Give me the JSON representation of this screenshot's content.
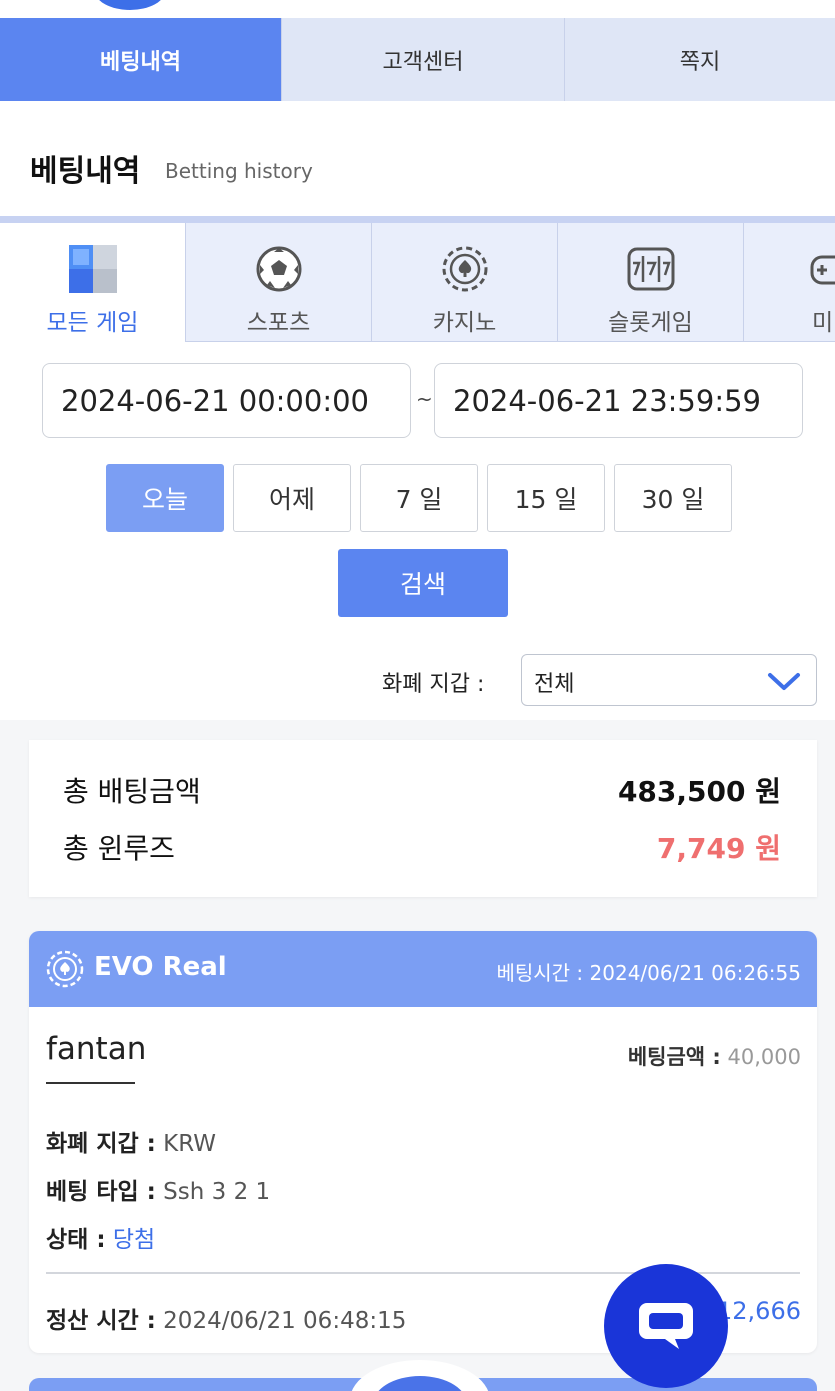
{
  "nav": {
    "tabs": [
      {
        "label": "베팅내역",
        "active": true
      },
      {
        "label": "고객센터",
        "active": false
      },
      {
        "label": "쪽지",
        "active": false
      }
    ]
  },
  "header": {
    "title": "베팅내역",
    "subtitle": "Betting history"
  },
  "game_tabs": [
    {
      "label": "모든 게임",
      "icon": "cube-icon",
      "active": true
    },
    {
      "label": "스포츠",
      "icon": "soccer-ball-icon"
    },
    {
      "label": "카지노",
      "icon": "casino-chip-icon"
    },
    {
      "label": "슬롯게임",
      "icon": "slot-machine-icon"
    },
    {
      "label": "미",
      "icon": "gamepad-icon"
    }
  ],
  "filter": {
    "date_from": "2024-06-21 00:00:00",
    "separator": "~",
    "date_to": "2024-06-21 23:59:59",
    "quick_ranges": [
      "오늘",
      "어제",
      "7 일",
      "15 일",
      "30 일"
    ],
    "active_range": "오늘",
    "search_label": "검색",
    "wallet_label": "화폐 지갑 :",
    "wallet_value": "전체"
  },
  "summary": {
    "total_bet_label": "총 배팅금액",
    "total_bet_value": "483,500 원",
    "total_winloss_label": "총 윈루즈",
    "total_winloss_value": "7,749 원"
  },
  "bet": {
    "provider": "EVO Real",
    "bet_time_label": "베팅시간 :",
    "bet_time": "2024/06/21 06:26:55",
    "game": "fantan",
    "amount_label": "베팅금액 :",
    "amount": "40,000",
    "currency_label": "화폐 지갑 :",
    "currency": "KRW",
    "type_label": "베팅 타입 :",
    "type": "Ssh 3 2 1",
    "status_label": "상태 :",
    "status": "당첨",
    "settle_label": "정산 시간 :",
    "settle_time": "2024/06/21 06:48:15",
    "payout": "12,666"
  },
  "colors": {
    "primary": "#5b85f0",
    "header_blue": "#7b9ef3",
    "nav_inactive": "#dfe6f6",
    "negative": "#ef6f6f",
    "chat_button": "#1a35d8"
  }
}
